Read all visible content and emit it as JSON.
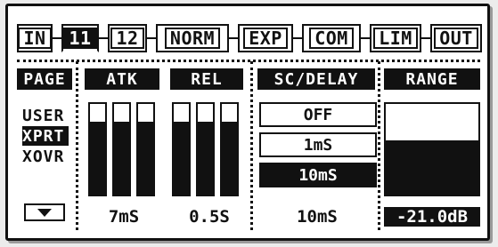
{
  "tabs": [
    {
      "label": "IN",
      "active": false
    },
    {
      "label": "11",
      "active": true
    },
    {
      "label": "12",
      "active": false
    },
    {
      "label": "NORM",
      "active": false
    },
    {
      "label": "EXP",
      "active": false
    },
    {
      "label": "COM",
      "active": false
    },
    {
      "label": "LIM",
      "active": false
    },
    {
      "label": "OUT",
      "active": false
    }
  ],
  "page": {
    "header": "PAGE",
    "items": [
      "USER",
      "XPRT",
      "XOVR"
    ],
    "selected": "XPRT"
  },
  "attack": {
    "header": "ATK",
    "meter_levels": [
      0.8,
      0.8,
      0.8
    ],
    "value": "7mS"
  },
  "release": {
    "header": "REL",
    "meter_levels": [
      0.8,
      0.8,
      0.8
    ],
    "value": "0.5S"
  },
  "sc_delay": {
    "header": "SC/DELAY",
    "options": [
      "OFF",
      "1mS",
      "10mS"
    ],
    "selected": "10mS",
    "value": "10mS"
  },
  "range": {
    "header": "RANGE",
    "level": 0.6,
    "value": "-21.0dB"
  },
  "colors": {
    "ink": "#111111",
    "paper": "#ffffff",
    "bezel": "#ececec"
  },
  "icons": {
    "page_down": "down-triangle-icon"
  }
}
